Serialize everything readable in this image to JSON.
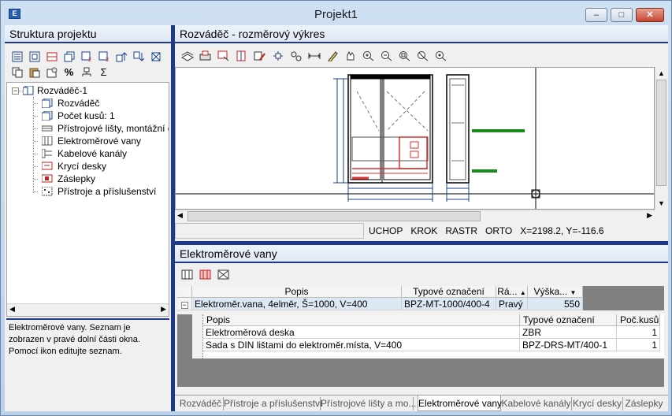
{
  "window": {
    "title": "Projekt1",
    "icon_label": "E",
    "minimize": "–",
    "maximize": "□",
    "close": "✕"
  },
  "left_panel": {
    "title": "Struktura projektu",
    "tree": {
      "root": "Rozváděč-1",
      "collapse_sign": "−",
      "items": [
        "Rozváděč",
        "Počet kusů: 1",
        "Přístrojové lišty, montážní desky",
        "Elektroměrové vany",
        "Kabelové kanály",
        "Krycí desky",
        "Záslepky",
        "Přístroje a příslušenství"
      ]
    },
    "description": "Elektroměrové vany. Seznam je zobrazen v pravé dolní části okna. Pomocí ikon editujte seznam."
  },
  "drawing_panel": {
    "title": "Rozváděč - rozměrový výkres",
    "status": {
      "snap": "UCHOP",
      "step": "KROK",
      "grid": "RASTR",
      "ortho": "ORTO",
      "coords": "X=2198.2, Y=-116.6"
    }
  },
  "list_panel": {
    "title": "Elektroměrové vany",
    "columns": [
      "Popis",
      "Typové označení",
      "Rá...",
      "Výška..."
    ],
    "rows": [
      {
        "popis": "Elektroměr.vana, 4elměr, Š=1000, V=400",
        "typ": "BPZ-MT-1000/400-4",
        "strana": "Pravý",
        "vyska": "550"
      }
    ],
    "subcolumns": [
      "Popis",
      "Typové označení",
      "Poč.kusů..."
    ],
    "subrows": [
      {
        "popis": "Elektroměrová deska",
        "typ": "ZBR",
        "pocet": "1"
      },
      {
        "popis": "Sada s DIN lištami do elektroměr.místa, V=400",
        "typ": "BPZ-DRS-MT/400-1",
        "pocet": "1"
      }
    ]
  },
  "tabs": [
    "Rozváděč",
    "Přístroje a příslušenství",
    "Přístrojové lišty a mo...",
    "Elektroměrové vany",
    "Kabelové kanály",
    "Krycí desky",
    "Záslepky"
  ],
  "active_tab": "Elektroměrové vany",
  "colors": {
    "accent_blue": "#1f3a8a",
    "highlight_red": "#e03030",
    "drawing_green": "#1a8a1a"
  }
}
